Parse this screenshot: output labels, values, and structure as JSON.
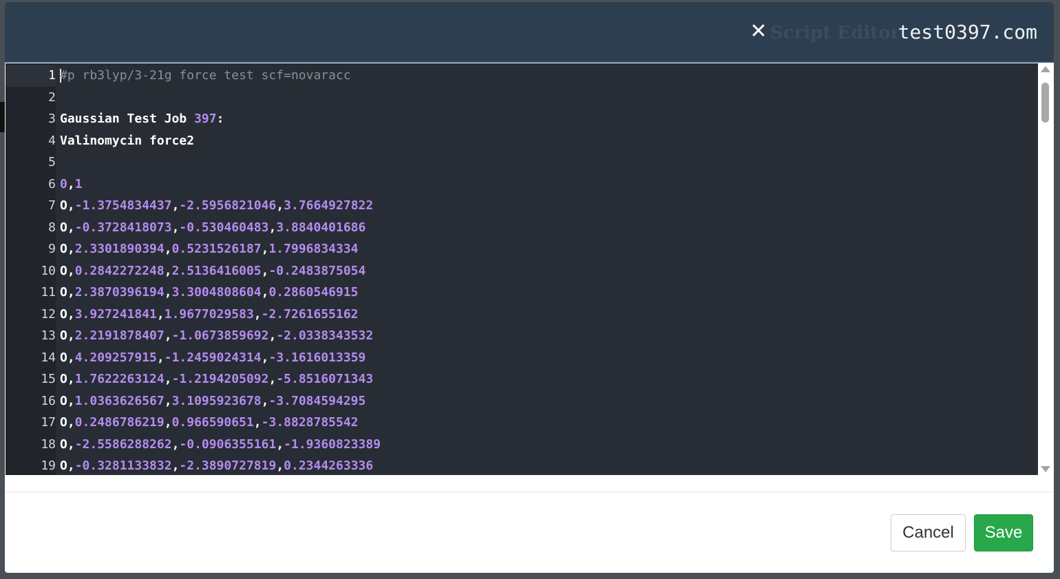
{
  "header": {
    "close_icon": "close-icon",
    "faded_title": "Script Editor",
    "title": "test0397.com"
  },
  "editor": {
    "lines": [
      {
        "n": "1",
        "tokens": [
          {
            "t": "#p rb3lyp/3-21g force test scf=novaracc",
            "k": "comment"
          }
        ]
      },
      {
        "n": "2",
        "tokens": []
      },
      {
        "n": "3",
        "tokens": [
          {
            "t": "Gaussian Test Job ",
            "k": "text"
          },
          {
            "t": "397",
            "k": "num"
          },
          {
            "t": ":",
            "k": "text"
          }
        ]
      },
      {
        "n": "4",
        "tokens": [
          {
            "t": "Valinomycin force2",
            "k": "text"
          }
        ]
      },
      {
        "n": "5",
        "tokens": []
      },
      {
        "n": "6",
        "tokens": [
          {
            "t": "0",
            "k": "num"
          },
          {
            "t": ",",
            "k": "text"
          },
          {
            "t": "1",
            "k": "num"
          }
        ]
      },
      {
        "n": "7",
        "tokens": [
          {
            "t": "O,",
            "k": "text"
          },
          {
            "t": "-1.3754834437",
            "k": "num"
          },
          {
            "t": ",",
            "k": "text"
          },
          {
            "t": "-2.5956821046",
            "k": "num"
          },
          {
            "t": ",",
            "k": "text"
          },
          {
            "t": "3.7664927822",
            "k": "num"
          }
        ]
      },
      {
        "n": "8",
        "tokens": [
          {
            "t": "O,",
            "k": "text"
          },
          {
            "t": "-0.3728418073",
            "k": "num"
          },
          {
            "t": ",",
            "k": "text"
          },
          {
            "t": "-0.530460483",
            "k": "num"
          },
          {
            "t": ",",
            "k": "text"
          },
          {
            "t": "3.8840401686",
            "k": "num"
          }
        ]
      },
      {
        "n": "9",
        "tokens": [
          {
            "t": "O,",
            "k": "text"
          },
          {
            "t": "2.3301890394",
            "k": "num"
          },
          {
            "t": ",",
            "k": "text"
          },
          {
            "t": "0.5231526187",
            "k": "num"
          },
          {
            "t": ",",
            "k": "text"
          },
          {
            "t": "1.7996834334",
            "k": "num"
          }
        ]
      },
      {
        "n": "10",
        "tokens": [
          {
            "t": "O,",
            "k": "text"
          },
          {
            "t": "0.2842272248",
            "k": "num"
          },
          {
            "t": ",",
            "k": "text"
          },
          {
            "t": "2.5136416005",
            "k": "num"
          },
          {
            "t": ",",
            "k": "text"
          },
          {
            "t": "-0.2483875054",
            "k": "num"
          }
        ]
      },
      {
        "n": "11",
        "tokens": [
          {
            "t": "O,",
            "k": "text"
          },
          {
            "t": "2.3870396194",
            "k": "num"
          },
          {
            "t": ",",
            "k": "text"
          },
          {
            "t": "3.3004808604",
            "k": "num"
          },
          {
            "t": ",",
            "k": "text"
          },
          {
            "t": "0.2860546915",
            "k": "num"
          }
        ]
      },
      {
        "n": "12",
        "tokens": [
          {
            "t": "O,",
            "k": "text"
          },
          {
            "t": "3.927241841",
            "k": "num"
          },
          {
            "t": ",",
            "k": "text"
          },
          {
            "t": "1.9677029583",
            "k": "num"
          },
          {
            "t": ",",
            "k": "text"
          },
          {
            "t": "-2.7261655162",
            "k": "num"
          }
        ]
      },
      {
        "n": "13",
        "tokens": [
          {
            "t": "O,",
            "k": "text"
          },
          {
            "t": "2.2191878407",
            "k": "num"
          },
          {
            "t": ",",
            "k": "text"
          },
          {
            "t": "-1.0673859692",
            "k": "num"
          },
          {
            "t": ",",
            "k": "text"
          },
          {
            "t": "-2.0338343532",
            "k": "num"
          }
        ]
      },
      {
        "n": "14",
        "tokens": [
          {
            "t": "O,",
            "k": "text"
          },
          {
            "t": "4.209257915",
            "k": "num"
          },
          {
            "t": ",",
            "k": "text"
          },
          {
            "t": "-1.2459024314",
            "k": "num"
          },
          {
            "t": ",",
            "k": "text"
          },
          {
            "t": "-3.1616013359",
            "k": "num"
          }
        ]
      },
      {
        "n": "15",
        "tokens": [
          {
            "t": "O,",
            "k": "text"
          },
          {
            "t": "1.7622263124",
            "k": "num"
          },
          {
            "t": ",",
            "k": "text"
          },
          {
            "t": "-1.2194205092",
            "k": "num"
          },
          {
            "t": ",",
            "k": "text"
          },
          {
            "t": "-5.8516071343",
            "k": "num"
          }
        ]
      },
      {
        "n": "16",
        "tokens": [
          {
            "t": "O,",
            "k": "text"
          },
          {
            "t": "1.0363626567",
            "k": "num"
          },
          {
            "t": ",",
            "k": "text"
          },
          {
            "t": "3.1095923678",
            "k": "num"
          },
          {
            "t": ",",
            "k": "text"
          },
          {
            "t": "-3.7084594295",
            "k": "num"
          }
        ]
      },
      {
        "n": "17",
        "tokens": [
          {
            "t": "O,",
            "k": "text"
          },
          {
            "t": "0.2486786219",
            "k": "num"
          },
          {
            "t": ",",
            "k": "text"
          },
          {
            "t": "0.966590651",
            "k": "num"
          },
          {
            "t": ",",
            "k": "text"
          },
          {
            "t": "-3.8828785542",
            "k": "num"
          }
        ]
      },
      {
        "n": "18",
        "tokens": [
          {
            "t": "O,",
            "k": "text"
          },
          {
            "t": "-2.5586288262",
            "k": "num"
          },
          {
            "t": ",",
            "k": "text"
          },
          {
            "t": "-0.0906355161",
            "k": "num"
          },
          {
            "t": ",",
            "k": "text"
          },
          {
            "t": "-1.9360823389",
            "k": "num"
          }
        ]
      },
      {
        "n": "19",
        "tokens": [
          {
            "t": "O,",
            "k": "text"
          },
          {
            "t": "-0.3281133832",
            "k": "num"
          },
          {
            "t": ",",
            "k": "text"
          },
          {
            "t": "-2.3890727819",
            "k": "num"
          },
          {
            "t": ",",
            "k": "text"
          },
          {
            "t": "0.2344263336",
            "k": "num"
          }
        ]
      }
    ],
    "colors": {
      "background": "#282c34",
      "gutter": "#21252b",
      "comment": "#8a8f98",
      "number": "#b38cf0",
      "text": "#ffffff"
    }
  },
  "footer": {
    "cancel_label": "Cancel",
    "save_label": "Save",
    "save_color": "#28a84a"
  }
}
